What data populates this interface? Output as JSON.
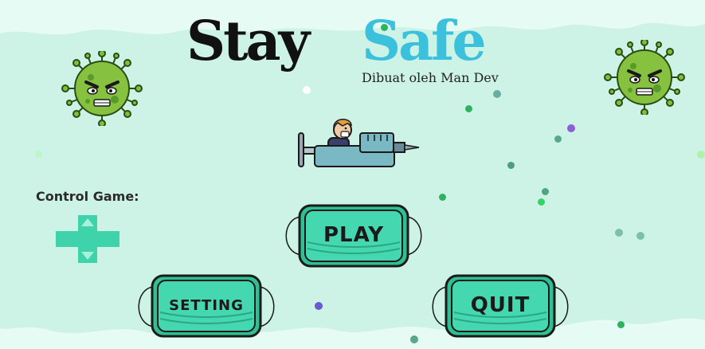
{
  "title": {
    "part1": "Stay",
    "part2": "Safe",
    "subtitle": "Dibuat oleh Man Dev"
  },
  "controls": {
    "label": "Control Game:"
  },
  "menu": {
    "play_label": "PLAY",
    "setting_label": "SETTING",
    "quit_label": "QUIT"
  },
  "colors": {
    "background": "#cdf3e6",
    "title_dark": "#111111",
    "title_accent": "#3cc1dd",
    "mask_fill": "#3fd3ab",
    "mask_border": "#1a1a1a",
    "dpad": "#3fd3ab",
    "virus": "#7fbf3a"
  }
}
